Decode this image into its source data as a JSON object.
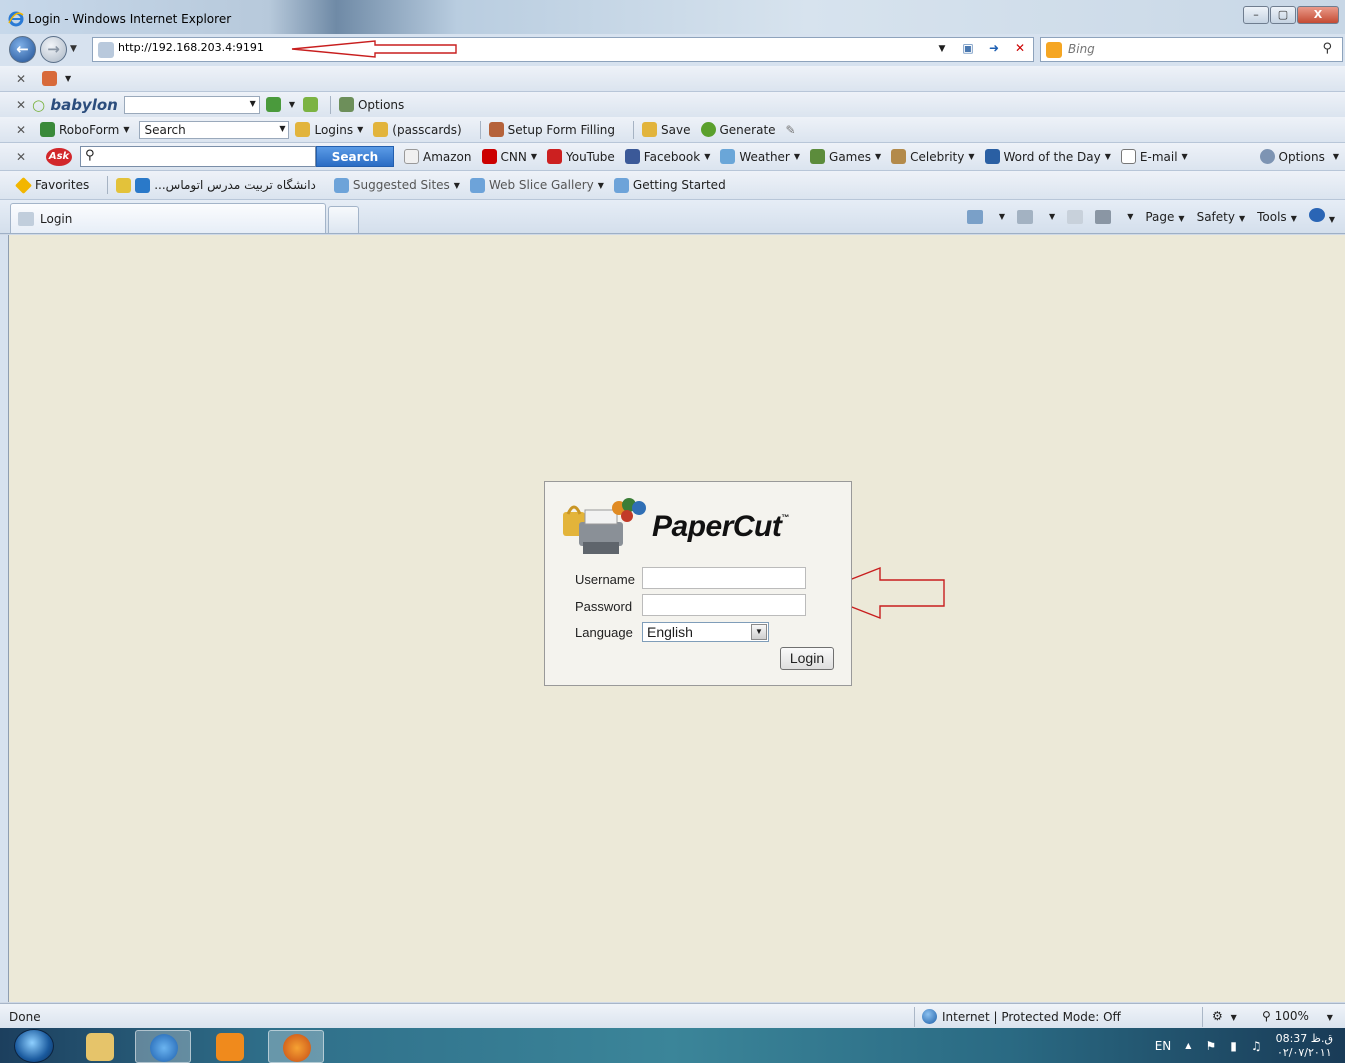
{
  "window": {
    "title": "Login - Windows Internet Explorer",
    "buttons": [
      "–",
      "▢",
      "X"
    ]
  },
  "address": {
    "url": "http://192.168.203.4:9191",
    "search_placeholder": "Bing"
  },
  "toolbars": {
    "babylon": {
      "logo": "babylon",
      "options_label": "Options"
    },
    "roboform": {
      "brand": "RoboForm",
      "search_label": "Search",
      "logins_label": "Logins",
      "passcards_label": "(passcards)",
      "setup_label": "Setup Form Filling",
      "save_label": "Save",
      "generate_label": "Generate"
    },
    "ask": {
      "logo": "Ask",
      "search_button": "Search",
      "links": [
        {
          "label": "Amazon",
          "icon": "amazon-icon",
          "color": "#f0f0f0"
        },
        {
          "label": "CNN",
          "icon": "cnn-icon",
          "color": "#cc0000"
        },
        {
          "label": "YouTube",
          "icon": "youtube-icon",
          "color": "#cc2020"
        },
        {
          "label": "Facebook",
          "icon": "facebook-icon",
          "color": "#3b5998"
        },
        {
          "label": "Weather",
          "icon": "weather-icon",
          "color": "#6aa6d8"
        },
        {
          "label": "Games",
          "icon": "games-icon",
          "color": "#5c8c3c"
        },
        {
          "label": "Celebrity",
          "icon": "celebrity-icon",
          "color": "#b38a4a"
        },
        {
          "label": "Word of the Day",
          "icon": "word-icon",
          "color": "#2a5fa3"
        },
        {
          "label": "E-mail",
          "icon": "email-icon",
          "color": "#ffffff"
        }
      ],
      "options_label": "Options"
    },
    "favorites": {
      "favorites_label": "Favorites",
      "items": [
        "...دانشگاه تربیت مدرس اتوماس",
        "Suggested Sites",
        "Web Slice Gallery",
        "Getting Started"
      ]
    }
  },
  "tab": {
    "label": "Login"
  },
  "commandbar": {
    "page": "Page",
    "safety": "Safety",
    "tools": "Tools"
  },
  "login": {
    "brand": "PaperCut",
    "tm": "™",
    "username_label": "Username",
    "password_label": "Password",
    "language_label": "Language",
    "language_value": "English",
    "login_button": "Login"
  },
  "statusbar": {
    "status": "Done",
    "zone": "Internet | Protected Mode: Off",
    "zoom": "100%"
  },
  "taskbar": {
    "lang": "EN",
    "time": "08:37 ق.ظ",
    "date": "۰۲/۰۷/۲۰۱۱"
  }
}
